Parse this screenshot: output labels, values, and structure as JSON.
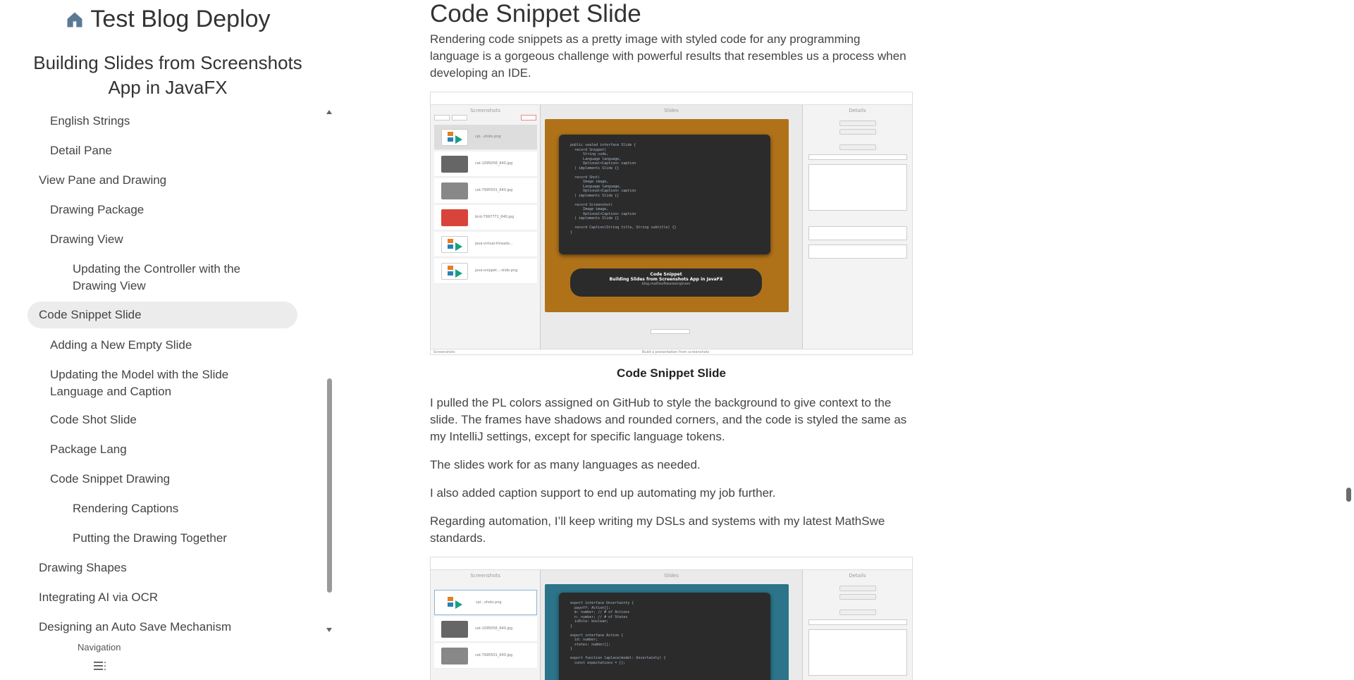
{
  "sidebar": {
    "site_title": "Test Blog Deploy",
    "article_title": "Building Slides from Screenshots App in JavaFX",
    "toc": [
      {
        "label": "English Strings",
        "level": 2
      },
      {
        "label": "Detail Pane",
        "level": 2
      },
      {
        "label": "View Pane and Drawing",
        "level": 1
      },
      {
        "label": "Drawing Package",
        "level": 2
      },
      {
        "label": "Drawing View",
        "level": 2
      },
      {
        "label": "Updating the Controller with the Drawing View",
        "level": 3
      },
      {
        "label": "Code Snippet Slide",
        "level": 1,
        "active": true
      },
      {
        "label": "Adding a New Empty Slide",
        "level": 2
      },
      {
        "label": "Updating the Model with the Slide Language and Caption",
        "level": 2
      },
      {
        "label": "Code Shot Slide",
        "level": 2
      },
      {
        "label": "Package Lang",
        "level": 2
      },
      {
        "label": "Code Snippet Drawing",
        "level": 2
      },
      {
        "label": "Rendering Captions",
        "level": 3
      },
      {
        "label": "Putting the Drawing Together",
        "level": 3
      },
      {
        "label": "Drawing Shapes",
        "level": 1
      },
      {
        "label": "Integrating AI via OCR",
        "level": 1
      },
      {
        "label": "Designing an Auto Save Mechanism",
        "level": 1
      }
    ],
    "nav_label": "Navigation"
  },
  "main": {
    "heading": "Code Snippet Slide",
    "intro": "Rendering code snippets as a pretty image with styled code for any programming language is a gorgeous challenge with powerful results that resembles us a process when developing an IDE.",
    "figure_caption": "Code Snippet Slide",
    "paragraphs": [
      "I pulled the PL colors assigned on GitHub to style the background to give context to the slide. The frames have shadows and rounded corners, and the code is styled the same as my IntelliJ settings, except for specific language tokens.",
      "The slides work for as many languages as needed.",
      "I also added caption support to end up automating my job further.",
      "Regarding automation, I’ll keep writing my DSLs and systems with my latest MathSwe standards."
    ]
  },
  "screenshot1": {
    "pane_titles": [
      "Screenshots",
      "Slides",
      "Details"
    ],
    "files": [
      "cpi...shots.png",
      "cat-1095056_640.jpg",
      "cat-7995501_640.jpg",
      "bird-7997771_640.jpg",
      "java-virtual-threads...",
      "java-snippet...-slide.png"
    ],
    "code": "public sealed interface Slide {\n  record Snippet(\n      String code,\n      Language language,\n      Optional<Caption> caption\n  ) implements Slide {}\n\n  record Shot(\n      Image image,\n      Language language,\n      Optional<Caption> caption\n  ) implements Slide {}\n\n  record Screenshot(\n      Image image,\n      Optional<Caption> caption\n  ) implements Slide {}\n\n  record Caption(String title, String subtitle) {}\n}",
    "caption_title": "Code Snippet",
    "caption_subtitle": "Building Slides from Screenshots App in JavaFX",
    "caption_url": "blog.mathsoftwareengineer",
    "status_left": "Screenshots",
    "status_center": "Build a presentation from screenshots",
    "colors": {
      "slide_bg": "#b07219"
    }
  },
  "screenshot2": {
    "pane_titles": [
      "Screenshots",
      "Slides",
      "Details"
    ],
    "files": [
      "cpi...shots.png",
      "cat-1095056_640.jpg",
      "cat-7995501_640.jpg"
    ],
    "code": "export interface Uncertainty {\n  payoff: Action[];\n  m: number; // # of Actions\n  n: number; // # of States\n  isEole: boolean;\n}\n\nexport interface Action {\n  id: number;\n  states: number[];\n}\n\nexport function laplace(model: Uncertainty) {\n  const expectations = [];",
    "colors": {
      "slide_bg": "#2b7489"
    }
  }
}
